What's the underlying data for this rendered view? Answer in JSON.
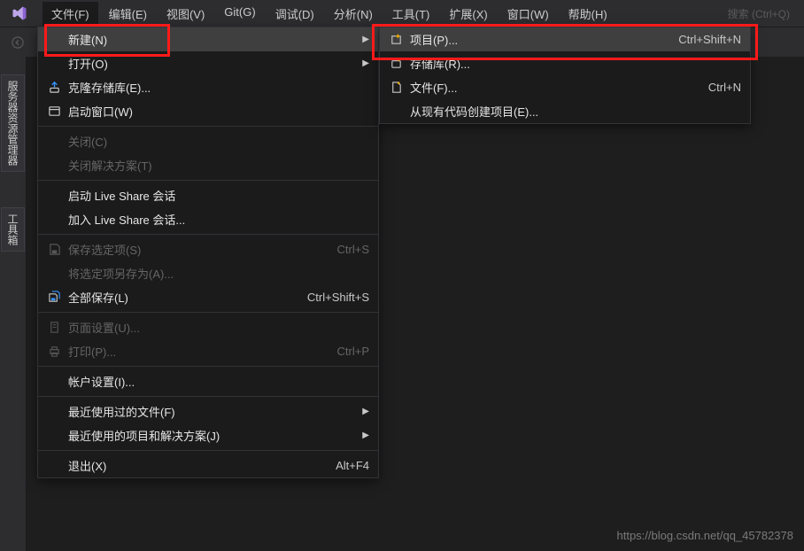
{
  "menubar": [
    "文件(F)",
    "编辑(E)",
    "视图(V)",
    "Git(G)",
    "调试(D)",
    "分析(N)",
    "工具(T)",
    "扩展(X)",
    "窗口(W)",
    "帮助(H)"
  ],
  "search_placeholder": "搜索 (Ctrl+Q)",
  "left_tabs": [
    "服务器资源管理器",
    "工具箱"
  ],
  "file_menu": [
    {
      "type": "item",
      "label": "新建(N)",
      "sub": true,
      "hover": true
    },
    {
      "type": "item",
      "label": "打开(O)",
      "sub": true
    },
    {
      "type": "item",
      "label": "克隆存储库(E)...",
      "icon": "clone"
    },
    {
      "type": "item",
      "label": "启动窗口(W)",
      "icon": "window"
    },
    {
      "type": "sep"
    },
    {
      "type": "item",
      "label": "关闭(C)",
      "disabled": true
    },
    {
      "type": "item",
      "label": "关闭解决方案(T)",
      "disabled": true
    },
    {
      "type": "sep"
    },
    {
      "type": "item",
      "label": "启动 Live Share 会话"
    },
    {
      "type": "item",
      "label": "加入 Live Share 会话..."
    },
    {
      "type": "sep"
    },
    {
      "type": "item",
      "label": "保存选定项(S)",
      "icon": "save",
      "shortcut": "Ctrl+S",
      "disabled": true
    },
    {
      "type": "item",
      "label": "将选定项另存为(A)...",
      "disabled": true
    },
    {
      "type": "item",
      "label": "全部保存(L)",
      "icon": "saveall",
      "shortcut": "Ctrl+Shift+S"
    },
    {
      "type": "sep"
    },
    {
      "type": "item",
      "label": "页面设置(U)...",
      "icon": "pagesetup",
      "disabled": true
    },
    {
      "type": "item",
      "label": "打印(P)...",
      "icon": "print",
      "shortcut": "Ctrl+P",
      "disabled": true
    },
    {
      "type": "sep"
    },
    {
      "type": "item",
      "label": "帐户设置(I)..."
    },
    {
      "type": "sep"
    },
    {
      "type": "item",
      "label": "最近使用过的文件(F)",
      "sub": true
    },
    {
      "type": "item",
      "label": "最近使用的项目和解决方案(J)",
      "sub": true
    },
    {
      "type": "sep"
    },
    {
      "type": "item",
      "label": "退出(X)",
      "shortcut": "Alt+F4"
    }
  ],
  "new_submenu": [
    {
      "label": "项目(P)...",
      "icon": "newproj",
      "shortcut": "Ctrl+Shift+N",
      "hover": true
    },
    {
      "label": "存储库(R)...",
      "icon": "repo"
    },
    {
      "label": "文件(F)...",
      "icon": "newfile",
      "shortcut": "Ctrl+N"
    },
    {
      "label": "从现有代码创建项目(E)..."
    }
  ],
  "watermark": "https://blog.csdn.net/qq_45782378"
}
